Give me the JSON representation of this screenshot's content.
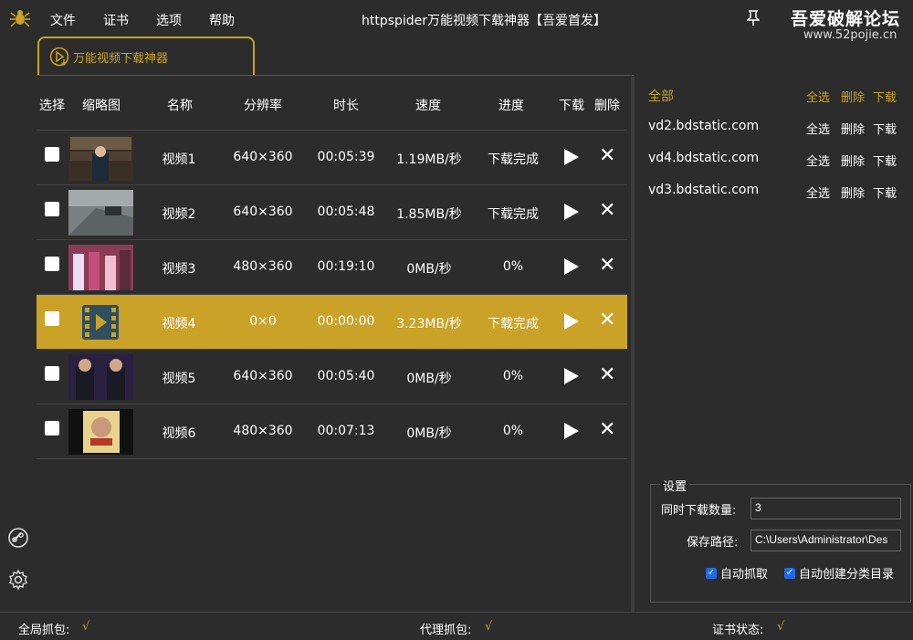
{
  "menu": {
    "app_icon": "spider-icon",
    "items": [
      "文件",
      "证书",
      "选项",
      "帮助"
    ]
  },
  "window": {
    "title": "httpspider万能视频下载神器【吾爱首发】"
  },
  "watermark": {
    "line1": "吾爱破解论坛",
    "line2": "www.52pojie.cn"
  },
  "tab": {
    "label": "万能视频下载神器"
  },
  "table": {
    "headers": [
      "选择",
      "缩略图",
      "名称",
      "分辨率",
      "时长",
      "速度",
      "进度",
      "下载",
      "删除"
    ],
    "rows": [
      {
        "name": "视频1",
        "resolution": "640×360",
        "duration": "00:05:39",
        "speed": "1.19MB/秒",
        "progress": "下载完成"
      },
      {
        "name": "视频2",
        "resolution": "640×360",
        "duration": "00:05:48",
        "speed": "1.85MB/秒",
        "progress": "下载完成"
      },
      {
        "name": "视频3",
        "resolution": "480×360",
        "duration": "00:19:10",
        "speed": "0MB/秒",
        "progress": "0%"
      },
      {
        "name": "视频4",
        "resolution": "0×0",
        "duration": "00:00:00",
        "speed": "3.23MB/秒",
        "progress": "下载完成"
      },
      {
        "name": "视频5",
        "resolution": "640×360",
        "duration": "00:05:40",
        "speed": "0MB/秒",
        "progress": "0%"
      },
      {
        "name": "视频6",
        "resolution": "480×360",
        "duration": "00:07:13",
        "speed": "0MB/秒",
        "progress": "0%"
      }
    ]
  },
  "hosts": {
    "all_label": "全部",
    "actions": {
      "select_all": "全选",
      "delete": "删除",
      "download": "下载"
    },
    "items": [
      "vd2.bdstatic.com",
      "vd4.bdstatic.com",
      "vd3.bdstatic.com"
    ]
  },
  "settings": {
    "legend": "设置",
    "concurrent_label": "同时下载数量:",
    "concurrent_value": "3",
    "path_label": "保存路径:",
    "path_value": "C:\\Users\\Administrator\\Des",
    "auto_capture_label": "自动抓取",
    "auto_folder_label": "自动创建分类目录"
  },
  "status": {
    "global_capture": "全局抓包:",
    "global_capture_value": "√",
    "proxy_capture": "代理抓包:",
    "proxy_capture_value": "√",
    "cert_status": "证书状态:",
    "cert_status_value": "√"
  },
  "colors": {
    "accent": "#c9a227",
    "background": "#2c2c2c",
    "checkbox": "#1e6ae5"
  }
}
